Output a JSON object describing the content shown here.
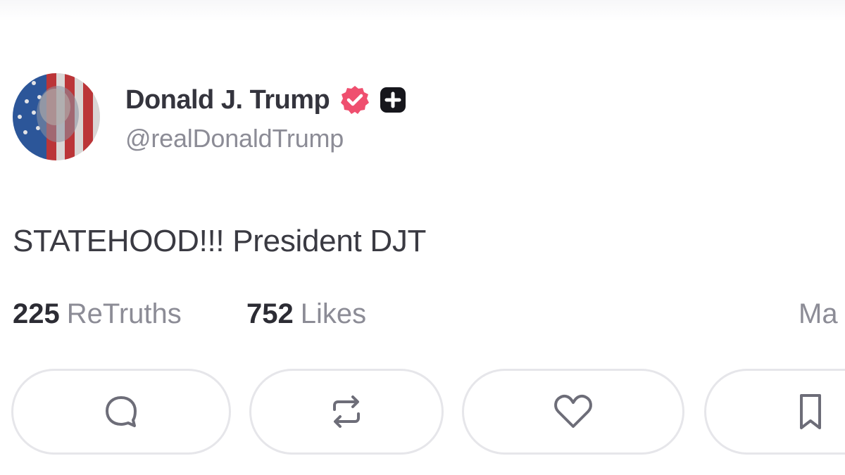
{
  "post": {
    "author": {
      "display_name": "Donald J. Trump",
      "handle": "@realDonaldTrump",
      "verified": true,
      "verified_color": "#ef4f6f",
      "avatar_icon": "flag-portrait-avatar",
      "badge_icon": "plus-badge-icon"
    },
    "text": "STATEHOOD!!! President DJT",
    "stats": {
      "retruths_count": "225",
      "retruths_label": "ReTruths",
      "likes_count": "752",
      "likes_label": "Likes",
      "timestamp": "Ma"
    },
    "actions": [
      {
        "name": "reply",
        "icon": "comment-bubble-icon"
      },
      {
        "name": "retruth",
        "icon": "repost-arrows-icon"
      },
      {
        "name": "like",
        "icon": "heart-icon"
      },
      {
        "name": "bookmark",
        "icon": "bookmark-icon"
      }
    ]
  },
  "colors": {
    "text_primary": "#34343d",
    "text_secondary": "#8c8c96",
    "border": "#e6e6ea",
    "verified": "#ef4f6f"
  }
}
